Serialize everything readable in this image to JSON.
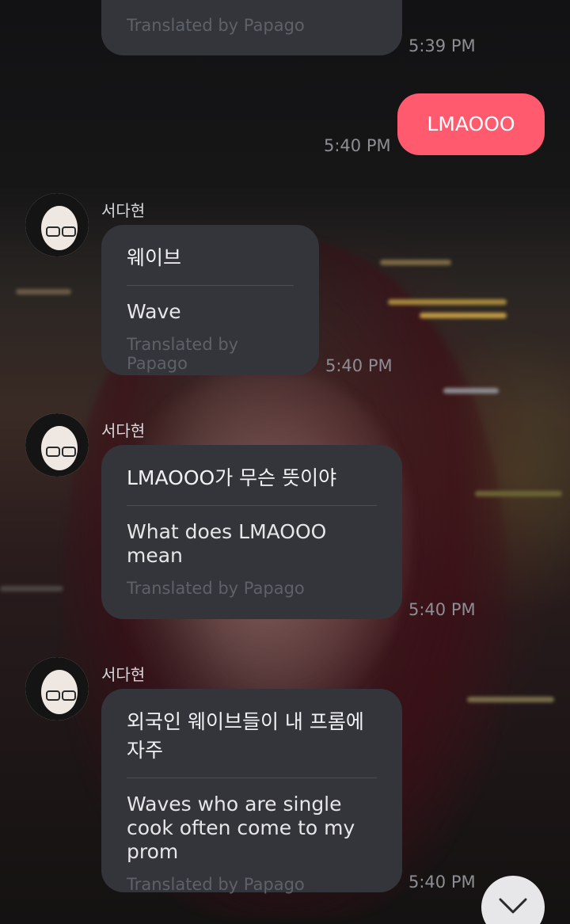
{
  "theme": {
    "sent_bubble_color": "#ff5a6e",
    "received_bubble_color": "#33353b"
  },
  "messages": [
    {
      "type": "received",
      "translation_credit": "Translated by Papago",
      "time": "5:39 PM"
    },
    {
      "type": "sent",
      "text": "LMAOOO",
      "time": "5:40 PM"
    },
    {
      "type": "received",
      "sender": "서다현",
      "original": "웨이브",
      "translation": "Wave",
      "translation_credit": "Translated by Papago",
      "time": "5:40 PM"
    },
    {
      "type": "received",
      "sender": "서다현",
      "original": "LMAOOO가 무슨 뜻이야",
      "translation": "What does LMAOOO mean",
      "translation_credit": "Translated by Papago",
      "time": "5:40 PM"
    },
    {
      "type": "received",
      "sender": "서다현",
      "original": "외국인 웨이브들이 내 프롬에 자주",
      "translation": "Waves who are single cook often come to my prom",
      "translation_credit": "Translated by Papago",
      "time": "5:40 PM"
    }
  ],
  "scroll_button": {
    "icon": "chevron-down-icon"
  }
}
